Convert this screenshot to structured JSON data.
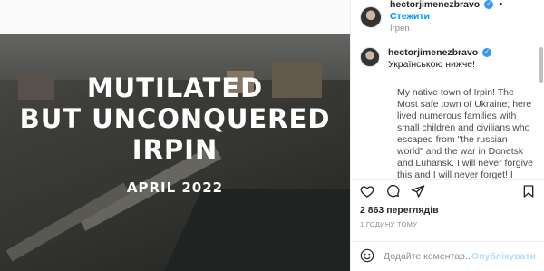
{
  "media": {
    "headline_line1": "MUTILATED",
    "headline_line2": "BUT UNCONQUERED",
    "headline_line3": "IRPIN",
    "date": "APRIL 2022"
  },
  "header": {
    "username": "hectorjimenezbravo",
    "separator": "•",
    "follow_label": "Стежити",
    "location": "Irpen"
  },
  "caption": {
    "username": "hectorjimenezbravo",
    "intro": "Українською нижче!",
    "text": "My native town of Irpin! The Most safe town of Ukraine; here lived numerous families with small children and civilians who escaped from \"the russian world\" and the war in Donetsk and Luhansk. I will never forgive this and I will never forget! I know that every Ukrainian like me will rather die than surrender to"
  },
  "stats": {
    "views": "2 863 переглядів",
    "time": "1 ГОДИНУ ТОМУ"
  },
  "comment": {
    "placeholder": "Додайте коментар...",
    "post_label": "Опублікувати"
  },
  "icons": {
    "like": "heart-icon",
    "comment": "speech-bubble-icon",
    "share": "paper-plane-icon",
    "save": "bookmark-icon",
    "emoji": "smiley-icon"
  },
  "colors": {
    "accent": "#0095f6",
    "verified": "#3897f0",
    "post_disabled": "#b2dffc"
  }
}
